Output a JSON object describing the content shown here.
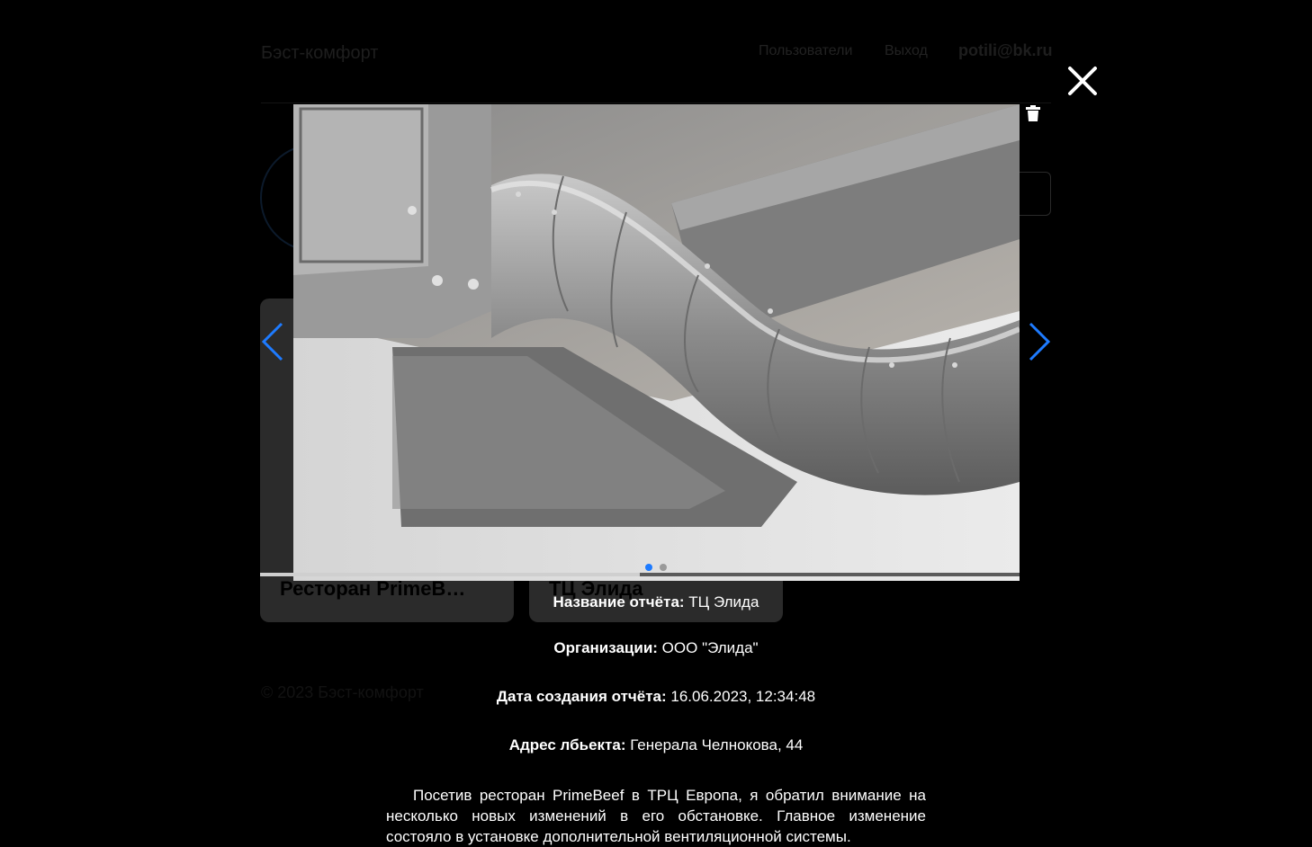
{
  "header": {
    "brand": "Бэст-комфорт",
    "nav_users": "Пользователи",
    "nav_exit": "Выход",
    "user_email": "potili@bk.ru"
  },
  "cards": [
    {
      "title": "Ресторан PrimeBeef"
    },
    {
      "title": "ТЦ Элида"
    }
  ],
  "footer": {
    "copyright": "© 2023 Бэст-комфорт"
  },
  "gallery": {
    "slide_count": 2,
    "active_slide": 0,
    "progress_fraction": 0.5,
    "accent_color": "#1e7bff"
  },
  "report": {
    "name_label": "Название отчёта:",
    "name_value": " ТЦ Элида",
    "org_label": "Организации:",
    "org_value": " ООО \"Элида\"",
    "date_label": "Дата создания отчёта:",
    "date_value": " 16.06.2023, 12:34:48",
    "address_label": "Адрес лбьекта:",
    "address_value": " Генерала Челнокова, 44",
    "description": "Посетив ресторан PrimeBeef в ТРЦ Европа, я обратил внимание на несколько новых изменений в его обстановке. Главное изменение состояло в установке дополнительной вентиляционной системы."
  },
  "icons": {
    "close": "close-icon",
    "trash": "trash-icon",
    "prev": "chevron-left-icon",
    "next": "chevron-right-icon"
  }
}
